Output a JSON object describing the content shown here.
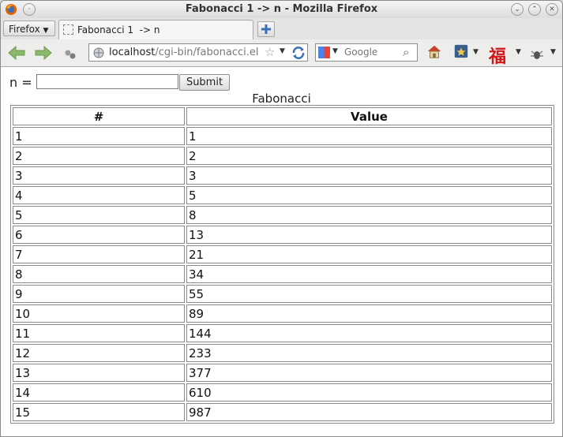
{
  "window": {
    "title": "Fabonacci 1 -> n - Mozilla Firefox"
  },
  "tabbar": {
    "menu_label": "Firefox",
    "tab_label": "Fabonacci 1  -> n"
  },
  "navbar": {
    "url_host": "localhost",
    "url_path": "/cgi-bin/fabonacci.el",
    "search_placeholder": "Google"
  },
  "form": {
    "n_label": "n =",
    "n_value": "",
    "submit_label": "Submit"
  },
  "table": {
    "caption": "Fabonacci",
    "headers": [
      "#",
      "Value"
    ],
    "rows": [
      [
        "1",
        "1"
      ],
      [
        "2",
        "2"
      ],
      [
        "3",
        "3"
      ],
      [
        "4",
        "5"
      ],
      [
        "5",
        "8"
      ],
      [
        "6",
        "13"
      ],
      [
        "7",
        "21"
      ],
      [
        "8",
        "34"
      ],
      [
        "9",
        "55"
      ],
      [
        "10",
        "89"
      ],
      [
        "11",
        "144"
      ],
      [
        "12",
        "233"
      ],
      [
        "13",
        "377"
      ],
      [
        "14",
        "610"
      ],
      [
        "15",
        "987"
      ]
    ]
  },
  "colors": {
    "window_bg": "#eeeeec",
    "border": "#8a8a8a",
    "text": "#111111"
  }
}
